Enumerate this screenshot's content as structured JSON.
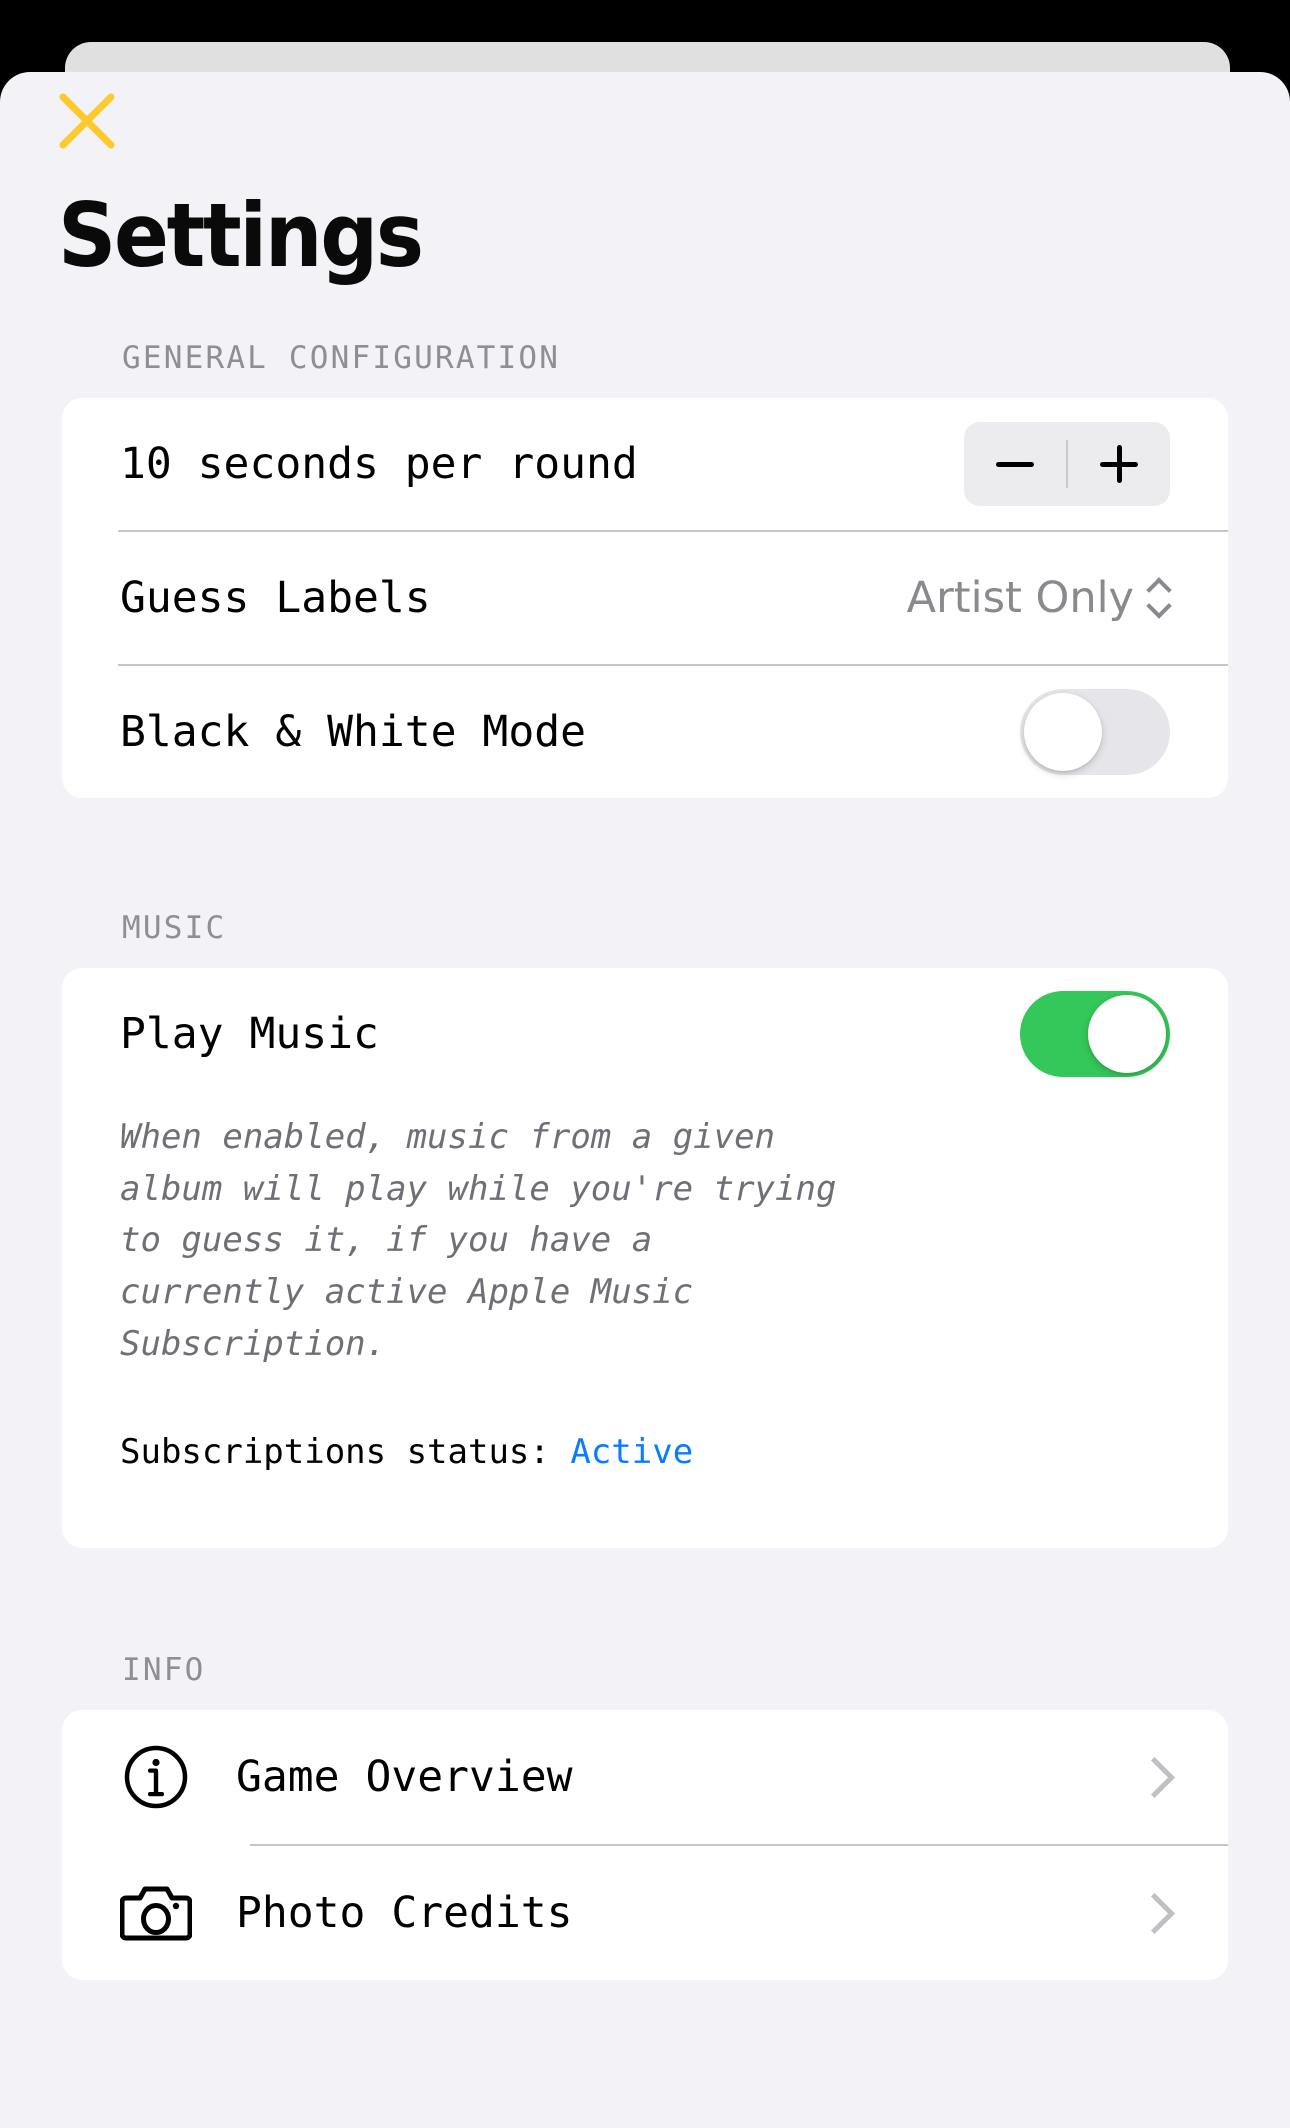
{
  "window": {
    "background_color": "#000000",
    "sheet_background": "#f2f2f7",
    "back_sheet_color": "#e0e0e0"
  },
  "header": {
    "close_label": "×",
    "close_icon_color": "#fdc92b",
    "title": "Settings"
  },
  "sections": [
    {
      "id": "general",
      "header": "GENERAL CONFIGURATION",
      "rows": [
        {
          "id": "round-duration",
          "label": "10 seconds per round",
          "control": "stepper",
          "decrement_label": "−",
          "increment_label": "+"
        },
        {
          "id": "guess-labels",
          "label": "Guess Labels",
          "control": "picker",
          "value": "Artist Only"
        },
        {
          "id": "black-white-mode",
          "label": "Black & White Mode",
          "control": "toggle",
          "state": "off"
        }
      ]
    },
    {
      "id": "music",
      "header": "MUSIC",
      "rows": [
        {
          "id": "play-music",
          "label": "Play Music",
          "control": "toggle",
          "state": "on"
        }
      ],
      "description": "When enabled, music from a given album will play while you're trying to guess it, if you have a currently active Apple Music Subscription.",
      "status_label": "Subscriptions status: ",
      "status_value": "Active",
      "status_value_color": "#0a7cff"
    },
    {
      "id": "info",
      "header": "INFO",
      "rows": [
        {
          "id": "game-overview",
          "label": "Game Overview",
          "icon": "info-circle-icon",
          "accessory": "chevron-right-icon"
        },
        {
          "id": "photo-credits",
          "label": "Photo Credits",
          "icon": "camera-icon",
          "accessory": "chevron-right-icon"
        }
      ]
    }
  ],
  "colors": {
    "toggle_on": "#34c759",
    "toggle_off": "#e6e6ea",
    "accent_link": "#0a7cff",
    "close_yellow": "#fdc92b",
    "secondary_text": "#8e8e93"
  }
}
